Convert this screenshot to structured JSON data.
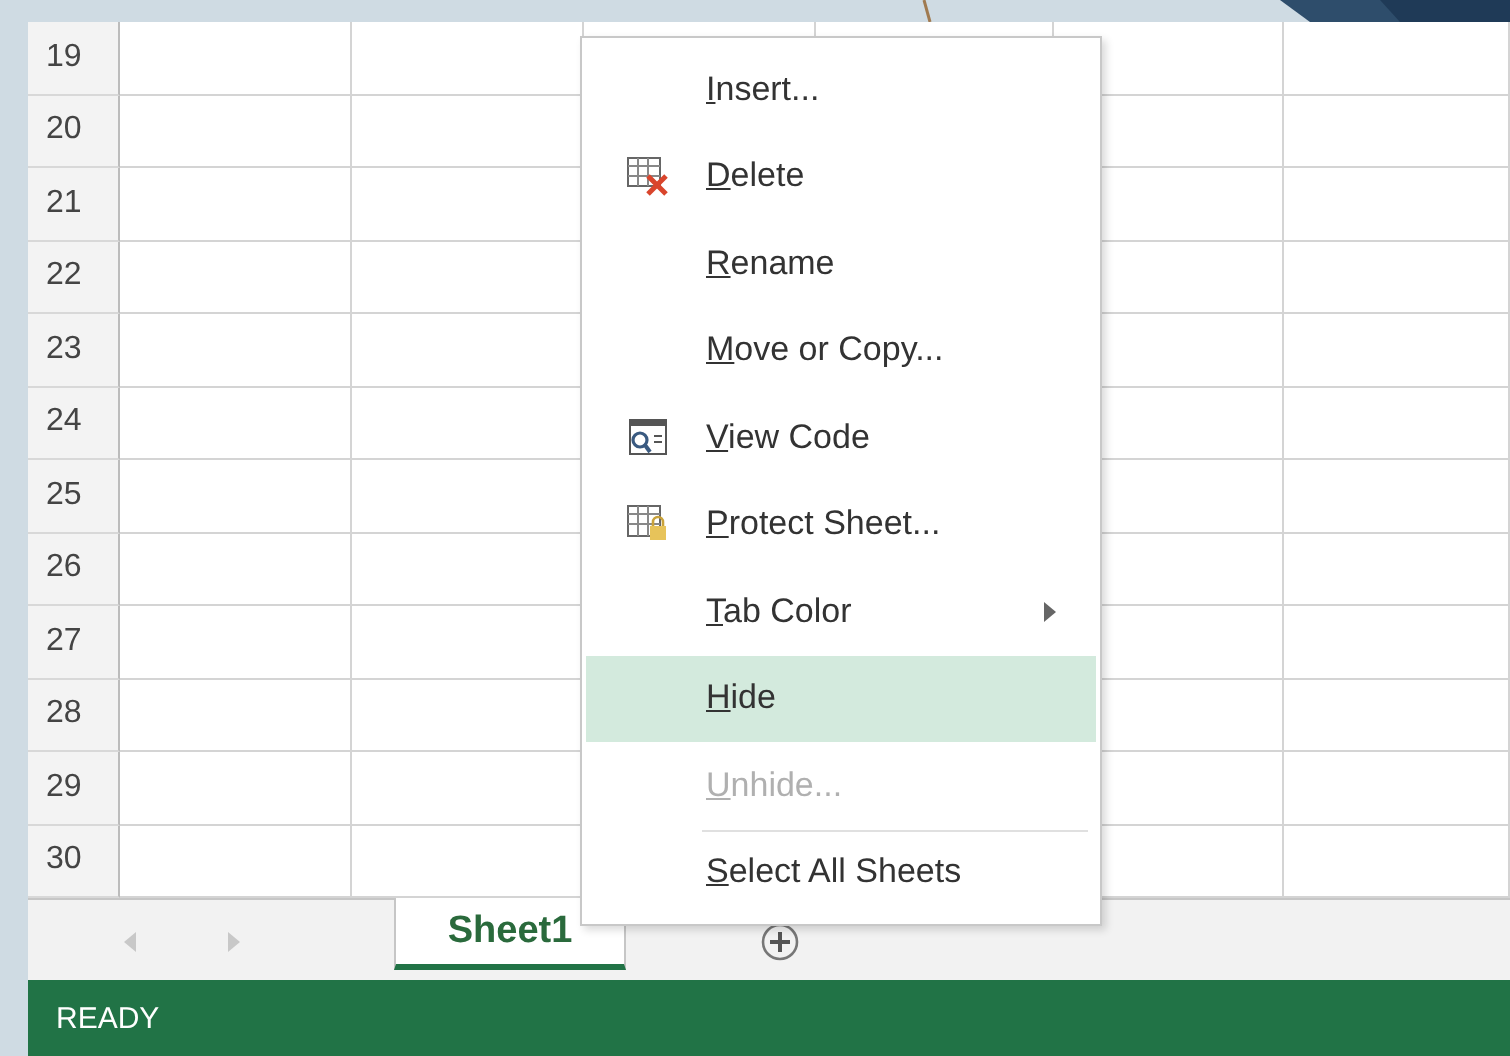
{
  "grid": {
    "rows": [
      "19",
      "20",
      "21",
      "22",
      "23",
      "24",
      "25",
      "26",
      "27",
      "28",
      "29",
      "30"
    ]
  },
  "context_menu": {
    "items": [
      {
        "label": "Insert...",
        "selected": false,
        "disabled": false,
        "submenu": false,
        "separator_before": false
      },
      {
        "label": "Delete",
        "selected": false,
        "disabled": false,
        "submenu": false,
        "separator_before": false
      },
      {
        "label": "Rename",
        "selected": false,
        "disabled": false,
        "submenu": false,
        "separator_before": false
      },
      {
        "label": "Move or Copy...",
        "selected": false,
        "disabled": false,
        "submenu": false,
        "separator_before": false
      },
      {
        "label": "View Code",
        "selected": false,
        "disabled": false,
        "submenu": false,
        "separator_before": false
      },
      {
        "label": "Protect Sheet...",
        "selected": false,
        "disabled": false,
        "submenu": false,
        "separator_before": false
      },
      {
        "label": "Tab Color",
        "selected": false,
        "disabled": false,
        "submenu": true,
        "separator_before": false
      },
      {
        "label": "Hide",
        "selected": true,
        "disabled": false,
        "submenu": false,
        "separator_before": false
      },
      {
        "label": "Unhide...",
        "selected": false,
        "disabled": true,
        "submenu": false,
        "separator_before": false
      },
      {
        "label": "Select All Sheets",
        "selected": false,
        "disabled": false,
        "submenu": false,
        "separator_before": true
      }
    ]
  },
  "sheet_tabs": [
    {
      "label": "Sheet1",
      "selected": true
    }
  ],
  "status_bar": {
    "text": "READY"
  }
}
